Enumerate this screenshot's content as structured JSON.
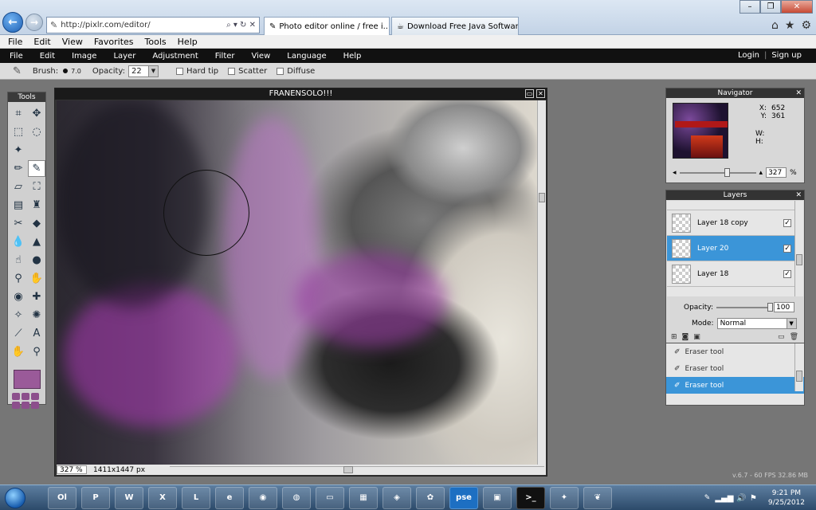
{
  "browser": {
    "url": "http://pixlr.com/editor/",
    "address_controls": "⌕ ▾ ↻ ✕",
    "tabs": [
      {
        "label": "Photo editor online / free i..."
      },
      {
        "label": "Download Free Java Software"
      }
    ],
    "menu": [
      "File",
      "Edit",
      "View",
      "Favorites",
      "Tools",
      "Help"
    ]
  },
  "pixlr": {
    "menu": [
      "File",
      "Edit",
      "Image",
      "Layer",
      "Adjustment",
      "Filter",
      "View",
      "Language",
      "Help"
    ],
    "auth": {
      "login": "Login",
      "separator": "|",
      "signup": "Sign up"
    },
    "options": {
      "brush_label": "Brush:",
      "brush_size": "7.0",
      "opacity_label": "Opacity:",
      "opacity_value": "22",
      "hard_tip": "Hard tip",
      "scatter": "Scatter",
      "diffuse": "Diffuse"
    },
    "tools_title": "Tools",
    "foreground_color": "#9a5a99",
    "image_window": {
      "title": "FRANENSOLO!!!",
      "zoom": "327 %",
      "dimensions": "1411x1447 px"
    },
    "navigator": {
      "title": "Navigator",
      "x_label": "X:",
      "x_value": "652",
      "y_label": "Y:",
      "y_value": "361",
      "w_label": "W:",
      "h_label": "H:",
      "zoom_value": "327",
      "zoom_unit": "%"
    },
    "layers": {
      "title": "Layers",
      "items": [
        {
          "name": "Layer 18 copy"
        },
        {
          "name": "Layer 20"
        },
        {
          "name": "Layer 18"
        }
      ],
      "opacity_label": "Opacity:",
      "opacity_value": "100",
      "mode_label": "Mode:",
      "mode_value": "Normal"
    },
    "history": {
      "items": [
        {
          "label": "Eraser tool"
        },
        {
          "label": "Eraser tool"
        },
        {
          "label": "Eraser tool"
        }
      ]
    },
    "version": "v.6.7 - 60 FPS 32.86 MB"
  },
  "taskbar": {
    "apps": [
      "Ol",
      "P",
      "W",
      "X",
      "L",
      "e",
      "◉",
      "◍",
      "▭",
      "▦",
      "◈",
      "✿",
      "pse",
      "▣",
      ">_",
      "✦",
      "❦",
      "✎"
    ],
    "time": "9:21 PM",
    "date": "9/25/2012"
  },
  "colors": {
    "accent_selection": "#3b95d8",
    "pixlr_menubar": "#111111",
    "brush_purple": "#9a5a99"
  }
}
